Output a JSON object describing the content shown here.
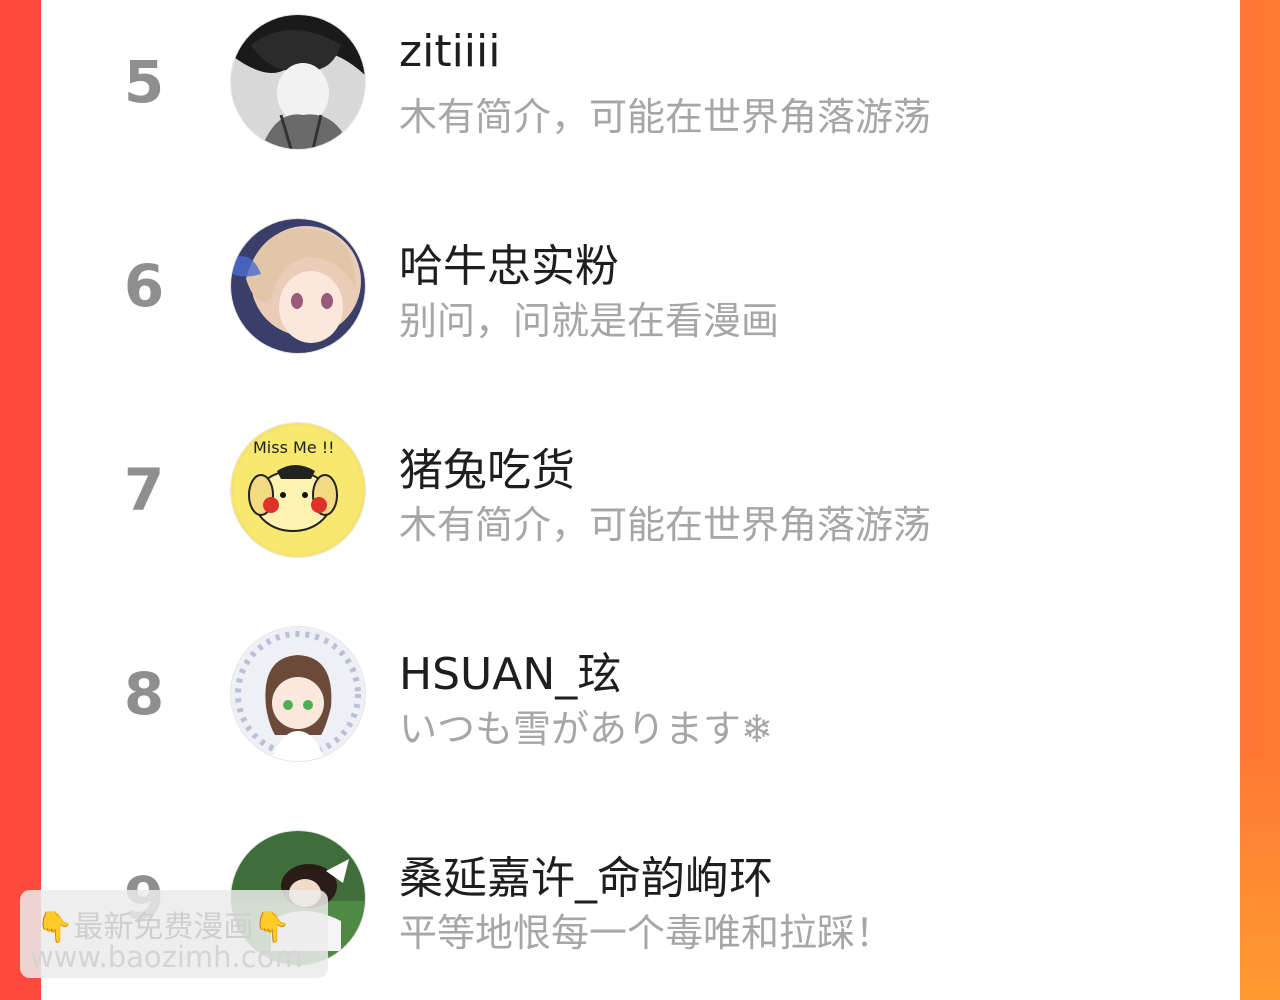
{
  "leaderboard": {
    "items": [
      {
        "rank": "5",
        "name": "zitiiii",
        "bio": "木有简介，可能在世界角落游荡",
        "avatar_icon": "manga-boy-avatar"
      },
      {
        "rank": "6",
        "name": "哈牛忠实粉",
        "bio": "别问，问就是在看漫画",
        "avatar_icon": "anime-girl-avatar"
      },
      {
        "rank": "7",
        "name": "猪兔吃货",
        "bio": "木有简介，可能在世界角落游荡",
        "avatar_icon": "yellow-dog-avatar"
      },
      {
        "rank": "8",
        "name": "HSUAN_玹",
        "bio": "いつも雪があります❄",
        "avatar_icon": "chibi-girl-avatar"
      },
      {
        "rank": "9",
        "name": "桑延嘉许_命韵峋环",
        "bio": "平等地恨每一个毒唯和拉踩！",
        "avatar_icon": "photo-girl-avatar"
      }
    ]
  },
  "watermark": {
    "line1": "最新免费漫画",
    "line2": "www.baozimh.com",
    "icon": "pointing-down-hand-icon"
  },
  "colors": {
    "frame_left": "#ff4a3d",
    "frame_right": "#ff7a35",
    "rank_gray": "#8f8f8f",
    "bio_gray": "#a6a6a6"
  }
}
